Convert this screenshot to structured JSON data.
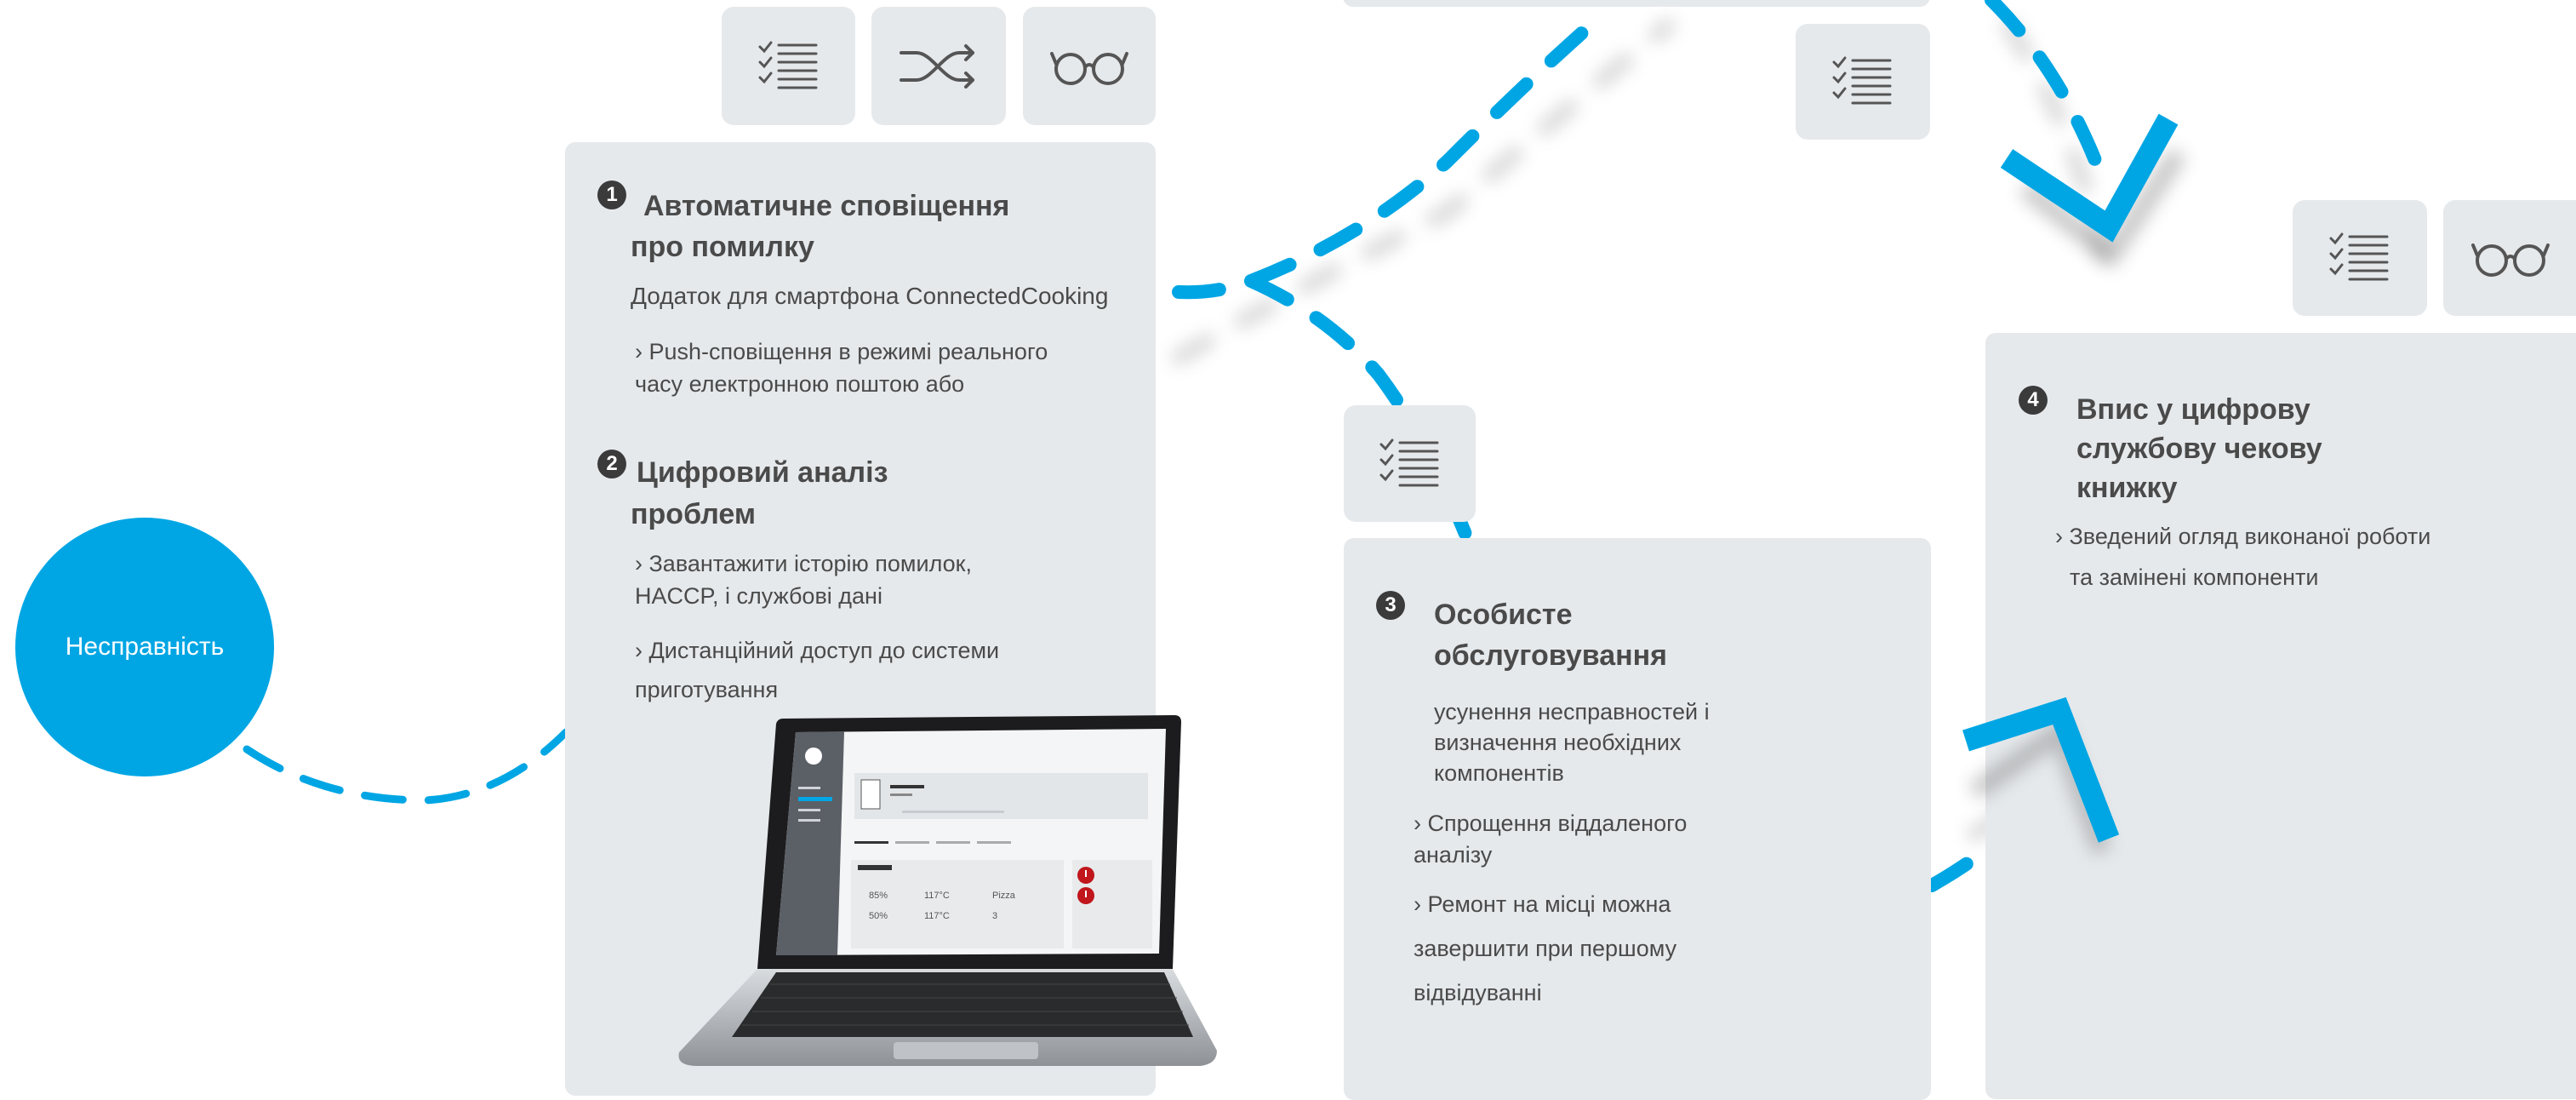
{
  "colors": {
    "accent": "#00a6e4",
    "card": "#e6e9ec",
    "text": "#4a4a4a",
    "badge": "#3b3b3b"
  },
  "icons": [
    "checklist-icon",
    "shuffle-icon",
    "glasses-icon"
  ],
  "malfunction": {
    "label": "Несправність"
  },
  "step1": {
    "number": "1",
    "title_line1": "Автоматичне сповіщення",
    "title_line2": "про помилку",
    "subtitle": "Додаток для смартфона ConnectedCooking",
    "bullet_line1": "› Push-сповіщення в режимі реального",
    "bullet_line2": "часу електронною поштою або"
  },
  "step2": {
    "number": "2",
    "title_line1": "Цифровий аналіз",
    "title_line2": "проблем",
    "bullet1_line1": "› Завантажити історію помилок,",
    "bullet1_line2": "HACCP, і службові дані",
    "bullet2_line1": "› Дистанційний доступ до системи",
    "bullet2_line2": "приготування"
  },
  "step3": {
    "number": "3",
    "title_line1": "Особисте",
    "title_line2": "обслуговування",
    "intro_line1": "усунення несправностей і",
    "intro_line2": "визначення необхідних",
    "intro_line3": "компонентів",
    "bullet1_line1": "› Спрощення віддаленого",
    "bullet1_line2": "аналізу",
    "bullet2_line1": "› Ремонт на місці можна",
    "bullet2_line2": "завершити  при першому",
    "bullet2_line3": "відвідуванні"
  },
  "step4": {
    "number": "4",
    "title_line1": "Впис у цифрову",
    "title_line2": "службову чекову",
    "title_line3": "книжку",
    "bullet_line1": "› Зведений огляд виконаної роботи",
    "bullet_line2": "та замінені компоненти"
  },
  "laptop": {
    "val1": "85%",
    "val2": "117°C",
    "val3": "Pizza",
    "val4": "50%",
    "val5": "117°C",
    "val6": "3"
  }
}
